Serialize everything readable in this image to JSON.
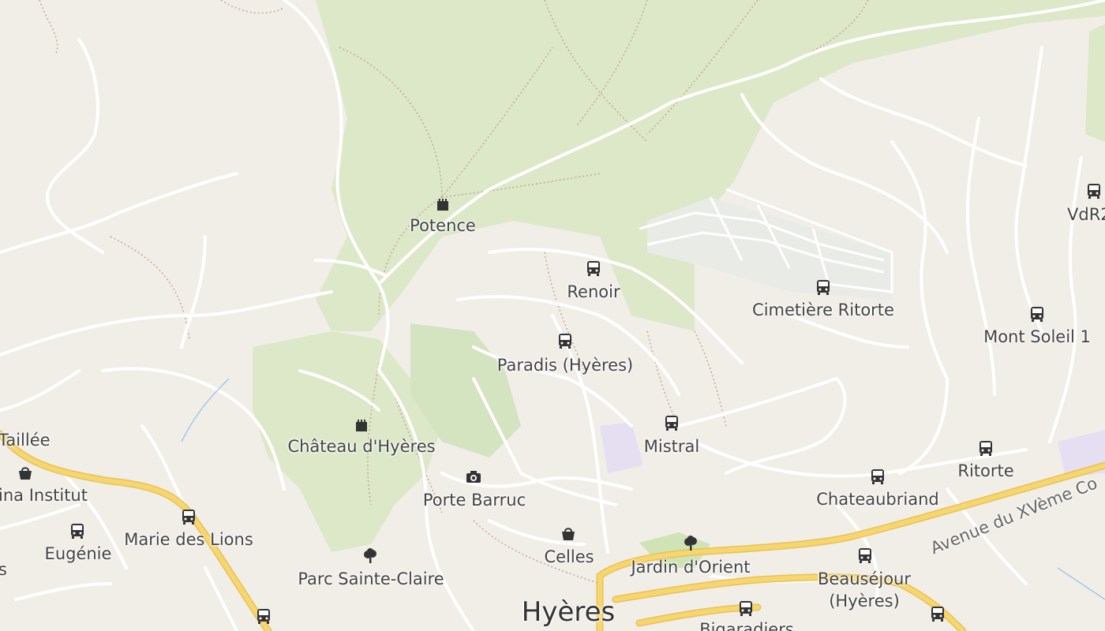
{
  "map": {
    "labels": {
      "taillee": "Taillée",
      "potence": "Potence",
      "renoir": "Renoir",
      "cimetiere_ritorte": "Cimetière Ritorte",
      "vdr": "VdR2",
      "mont_soleil": "Mont Soleil 1",
      "paradis": "Paradis (Hyères)",
      "mistral": "Mistral",
      "ritorte": "Ritorte",
      "chateau": "Château d'Hyères",
      "institut": "ina Institut",
      "porte_barruc": "Porte Barruc",
      "chateaubriand": "Chateaubriand",
      "eugenie": "Eugénie",
      "marie_des_lions": "Marie des Lions",
      "s_edge": "s",
      "celles": "Celles",
      "jardin": "Jardin d'Orient",
      "beausejour_1": "Beauséjour",
      "beausejour_2": "(Hyères)",
      "parc": "Parc Sainte-Claire",
      "hyeres": "Hyères",
      "bigaradiers": "Bigaradiers",
      "avenue": "Avenue du XVème Co"
    },
    "icons": [
      "bus-stop-icon",
      "castle-icon",
      "viewpoint-icon",
      "shop-icon",
      "park-tree-icon"
    ],
    "colors": {
      "land": "#f1eee8",
      "forest": "#dce8c8",
      "park": "#cfe3b5",
      "primary_road": "#f6d66f",
      "road": "#ffffff",
      "school": "#e6dff2"
    }
  }
}
